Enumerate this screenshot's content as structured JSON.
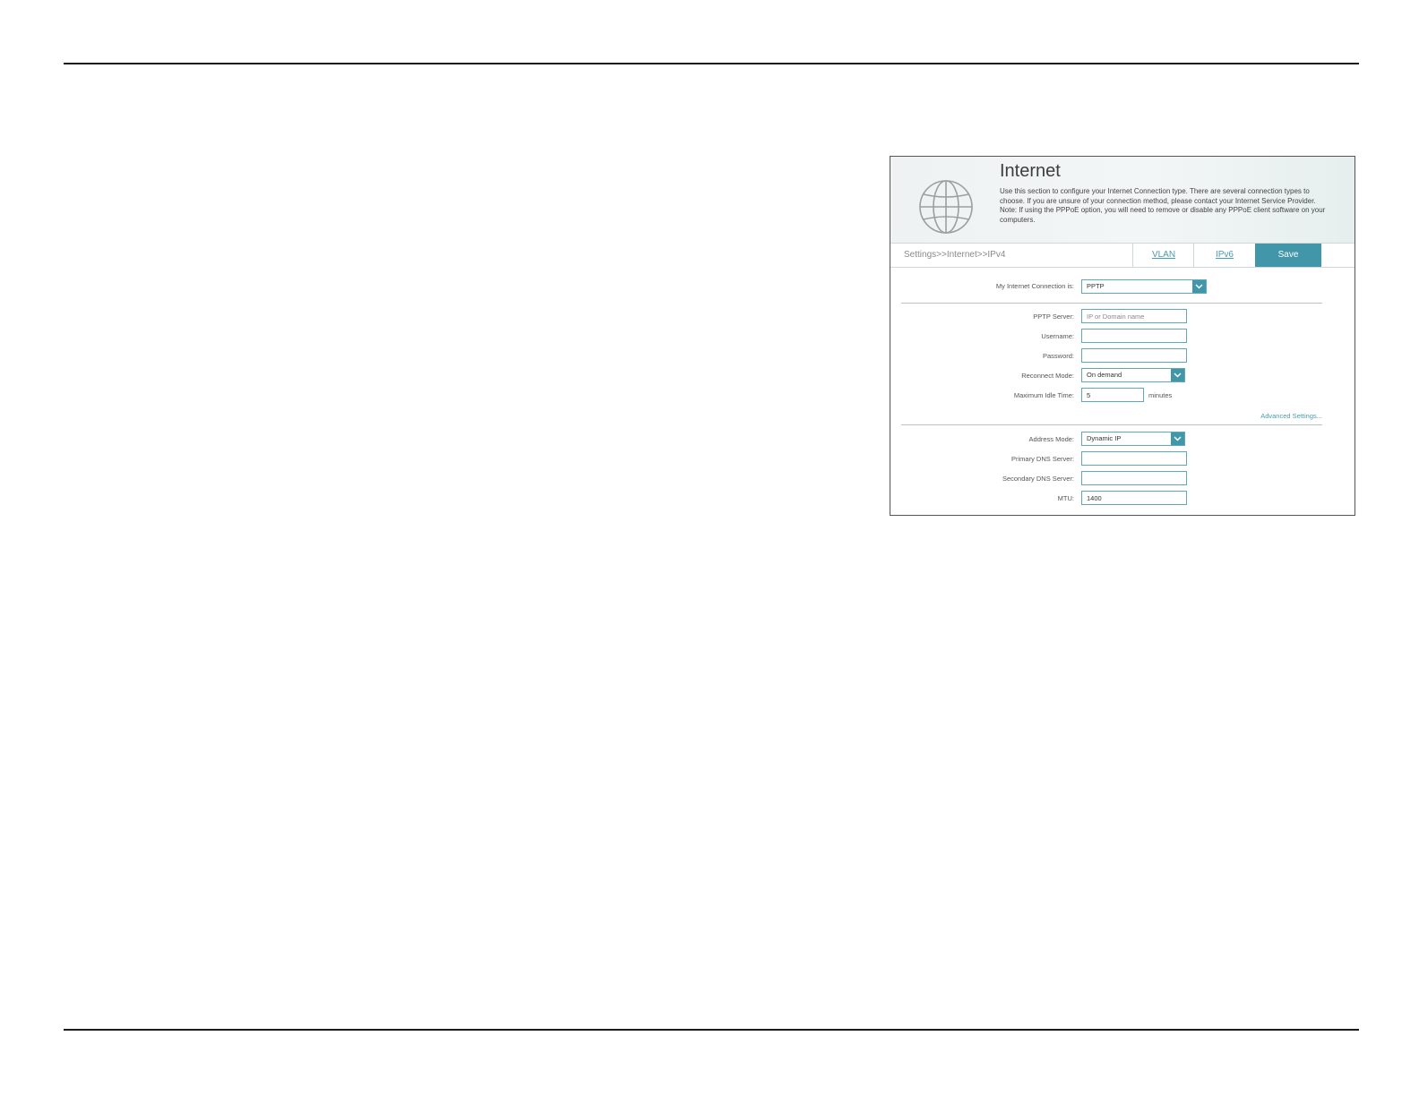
{
  "internet_panel": {
    "title": "Internet",
    "description": "Use this section to configure your Internet Connection type. There are several connection types to choose. If you are unsure of your connection method, please contact your Internet Service Provider. Note: If using the PPPoE option, you will need to remove or disable any PPPoE client software on your computers.",
    "breadcrumb": "Settings>>Internet>>IPv4",
    "tabs": {
      "vlan": "VLAN",
      "ipv6": "IPv6"
    },
    "save_label": "Save",
    "connection": {
      "label": "My Internet Connection is:",
      "value": "PPTP"
    },
    "pptp_server": {
      "label": "PPTP Server:",
      "value": "",
      "placeholder": "IP or Domain name"
    },
    "username": {
      "label": "Username:",
      "value": ""
    },
    "password": {
      "label": "Password:",
      "value": ""
    },
    "reconnect_mode": {
      "label": "Reconnect Mode:",
      "value": "On demand"
    },
    "max_idle_time": {
      "label": "Maximum Idle Time:",
      "value": "5",
      "unit": "minutes"
    },
    "advanced_settings": "Advanced Settings...",
    "address_mode": {
      "label": "Address Mode:",
      "value": "Dynamic IP"
    },
    "primary_dns": {
      "label": "Primary DNS Server:",
      "value": ""
    },
    "secondary_dns": {
      "label": "Secondary DNS Server:",
      "value": ""
    },
    "mtu": {
      "label": "MTU:",
      "value": "1400"
    },
    "colors": {
      "accent": "#4296a9",
      "link": "#4a9bb0",
      "input_border": "#5fa8b8"
    }
  }
}
